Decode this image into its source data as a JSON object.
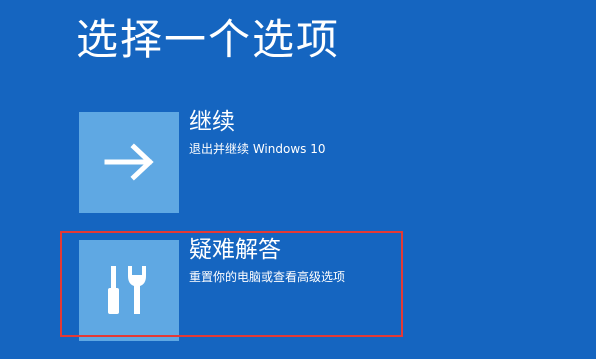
{
  "page": {
    "title": "选择一个选项"
  },
  "options": [
    {
      "label": "继续",
      "description": "退出并继续 Windows 10",
      "icon": "arrow-right-icon"
    },
    {
      "label": "疑难解答",
      "description": "重置你的电脑或查看高级选项",
      "icon": "tools-icon"
    }
  ],
  "colors": {
    "background": "#1565c0",
    "tile": "#5fa8e3",
    "text": "#ffffff",
    "highlight_border": "#e53935"
  }
}
